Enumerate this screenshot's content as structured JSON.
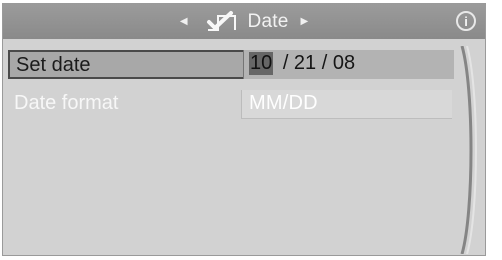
{
  "header": {
    "title": "Date",
    "left_arrow_icon": "left-arrow-icon",
    "right_arrow_icon": "right-arrow-icon",
    "check_icon": "checkmark-box-icon",
    "info_icon": "info-icon",
    "info_glyph": "i"
  },
  "menu": {
    "items": [
      {
        "label": "Set date",
        "value": {
          "month": "10",
          "rest": "/ 21 / 08"
        }
      },
      {
        "label": "Date format",
        "value": "MM/DD"
      }
    ]
  },
  "colors": {
    "header_bg": "#8f8f8f",
    "panel_bg": "#d2d2d2",
    "selected_row_bg": "#a8a8a8",
    "highlight_field_bg": "#666666",
    "text_light": "#f7f7f7",
    "text_dark": "#1b1b1b"
  }
}
